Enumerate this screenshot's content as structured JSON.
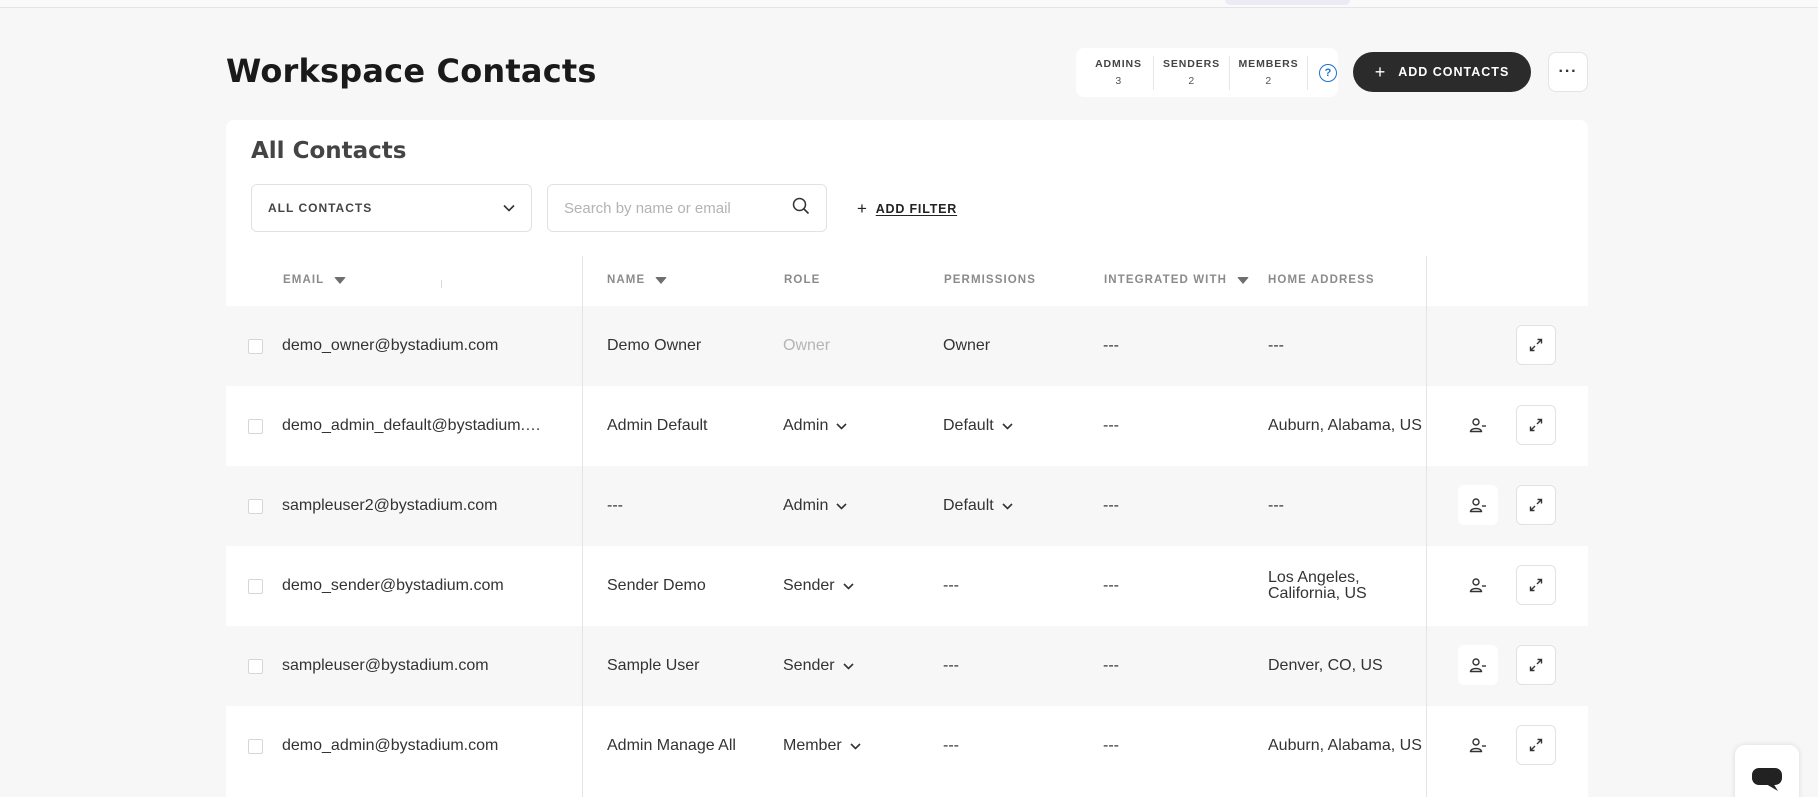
{
  "page": {
    "title": "Workspace Contacts"
  },
  "role_stats": [
    {
      "label": "ADMINS",
      "count": "3"
    },
    {
      "label": "SENDERS",
      "count": "2"
    },
    {
      "label": "MEMBERS",
      "count": "2"
    }
  ],
  "header": {
    "add_contacts_label": "ADD CONTACTS",
    "more_label": "···"
  },
  "section": {
    "title": "All Contacts",
    "filter_select": "ALL CONTACTS",
    "search_placeholder": "Search by name or email",
    "add_filter_label": "ADD FILTER"
  },
  "table": {
    "columns": {
      "email": "EMAIL",
      "name": "NAME",
      "role": "ROLE",
      "permissions": "PERMISSIONS",
      "integrated_with": "INTEGRATED WITH",
      "home_address": "HOME ADDRESS"
    },
    "rows": [
      {
        "email": "demo_owner@bystadium.com",
        "name": "Demo Owner",
        "role": "Owner",
        "permissions": "Owner",
        "integrated_with": "---",
        "home_address": "---"
      },
      {
        "email": "demo_admin_default@bystadium.…",
        "name": "Admin Default",
        "role": "Admin",
        "permissions": "Default",
        "integrated_with": "---",
        "home_address": "Auburn, Alabama, US"
      },
      {
        "email": "sampleuser2@bystadium.com",
        "name": "---",
        "role": "Admin",
        "permissions": "Default",
        "integrated_with": "---",
        "home_address": "---"
      },
      {
        "email": "demo_sender@bystadium.com",
        "name": "Sender Demo",
        "role": "Sender",
        "permissions": "---",
        "integrated_with": "---",
        "home_address_line1": "Los Angeles,",
        "home_address_line2": "California, US"
      },
      {
        "email": "sampleuser@bystadium.com",
        "name": "Sample User",
        "role": "Sender",
        "permissions": "---",
        "integrated_with": "---",
        "home_address": "Denver, CO, US"
      },
      {
        "email": "demo_admin@bystadium.com",
        "name": "Admin Manage All",
        "role": "Member",
        "permissions": "---",
        "integrated_with": "---",
        "home_address": "Auburn, Alabama, US"
      }
    ]
  },
  "icons": [
    "help-icon",
    "plus-icon",
    "more-icon",
    "chevron-down-icon",
    "search-icon",
    "sort-caret-icon",
    "user-remove-icon",
    "expand-icon",
    "chat-icon"
  ],
  "colors": {
    "primary_button": "#2b2b2b",
    "help_accent": "#1e6fd0",
    "background": "#f7f7f7"
  }
}
